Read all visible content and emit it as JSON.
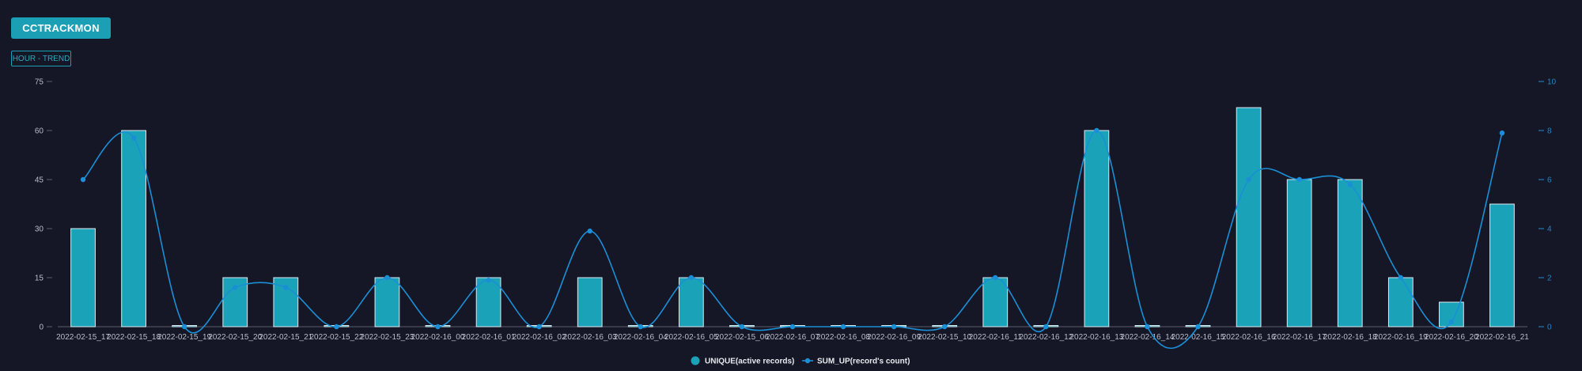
{
  "header": {
    "title": "CCTRACKMON",
    "trend_label": "HOUR - TREND"
  },
  "colors": {
    "background": "#161726",
    "bar_fill": "#1aa3b8",
    "bar_stroke": "#dfe9f0",
    "line": "#1a8fd6",
    "axis": "#5a5d6e"
  },
  "chart_data": {
    "type": "bar",
    "categories": [
      "2022-02-15_17",
      "2022-02-15_18",
      "2022-02-15_19",
      "2022-02-15_20",
      "2022-02-15_21",
      "2022-02-15_22",
      "2022-02-15_23",
      "2022-02-16_00",
      "2022-02-16_01",
      "2022-02-16_02",
      "2022-02-16_03",
      "2022-02-16_04",
      "2022-02-16_05",
      "2022-02-15_06",
      "2022-02-16_07",
      "2022-02-16_08",
      "2022-02-16_09",
      "2022-02-15_10",
      "2022-02-16_11",
      "2022-02-16_12",
      "2022-02-16_13",
      "2022-02-16_14",
      "2022-02-16_15",
      "2022-02-16_16",
      "2022-02-16_17",
      "2022-02-16_18",
      "2022-02-16_19",
      "2022-02-16_20",
      "2022-02-16_21"
    ],
    "series": [
      {
        "name": "UNIQUE(active records)",
        "type": "bar",
        "axis": "left",
        "values": [
          30,
          60,
          0,
          15,
          15,
          0,
          15,
          0,
          15,
          0,
          15,
          0,
          15,
          0,
          0,
          0,
          0,
          0,
          15,
          0,
          60,
          0,
          0,
          67,
          45,
          45,
          15,
          7.5,
          37.5
        ]
      },
      {
        "name": "SUM_UP(record's count)",
        "type": "line",
        "axis": "right",
        "values": [
          6,
          7.7,
          0,
          1.6,
          1.6,
          0,
          2,
          0,
          1.9,
          0,
          3.9,
          0,
          2,
          0,
          0,
          0,
          0,
          0,
          2,
          0,
          8,
          0,
          0,
          6,
          6,
          5.8,
          2,
          0.2,
          7.9
        ]
      }
    ],
    "y_left": {
      "ticks": [
        "0",
        "15",
        "30",
        "45",
        "60",
        "75"
      ],
      "ylim": [
        0,
        75
      ]
    },
    "y_right": {
      "ticks": [
        "0",
        "2",
        "4",
        "6",
        "8",
        "10"
      ],
      "ylim": [
        0,
        10
      ]
    },
    "grid": false,
    "legend_position": "bottom-center"
  }
}
